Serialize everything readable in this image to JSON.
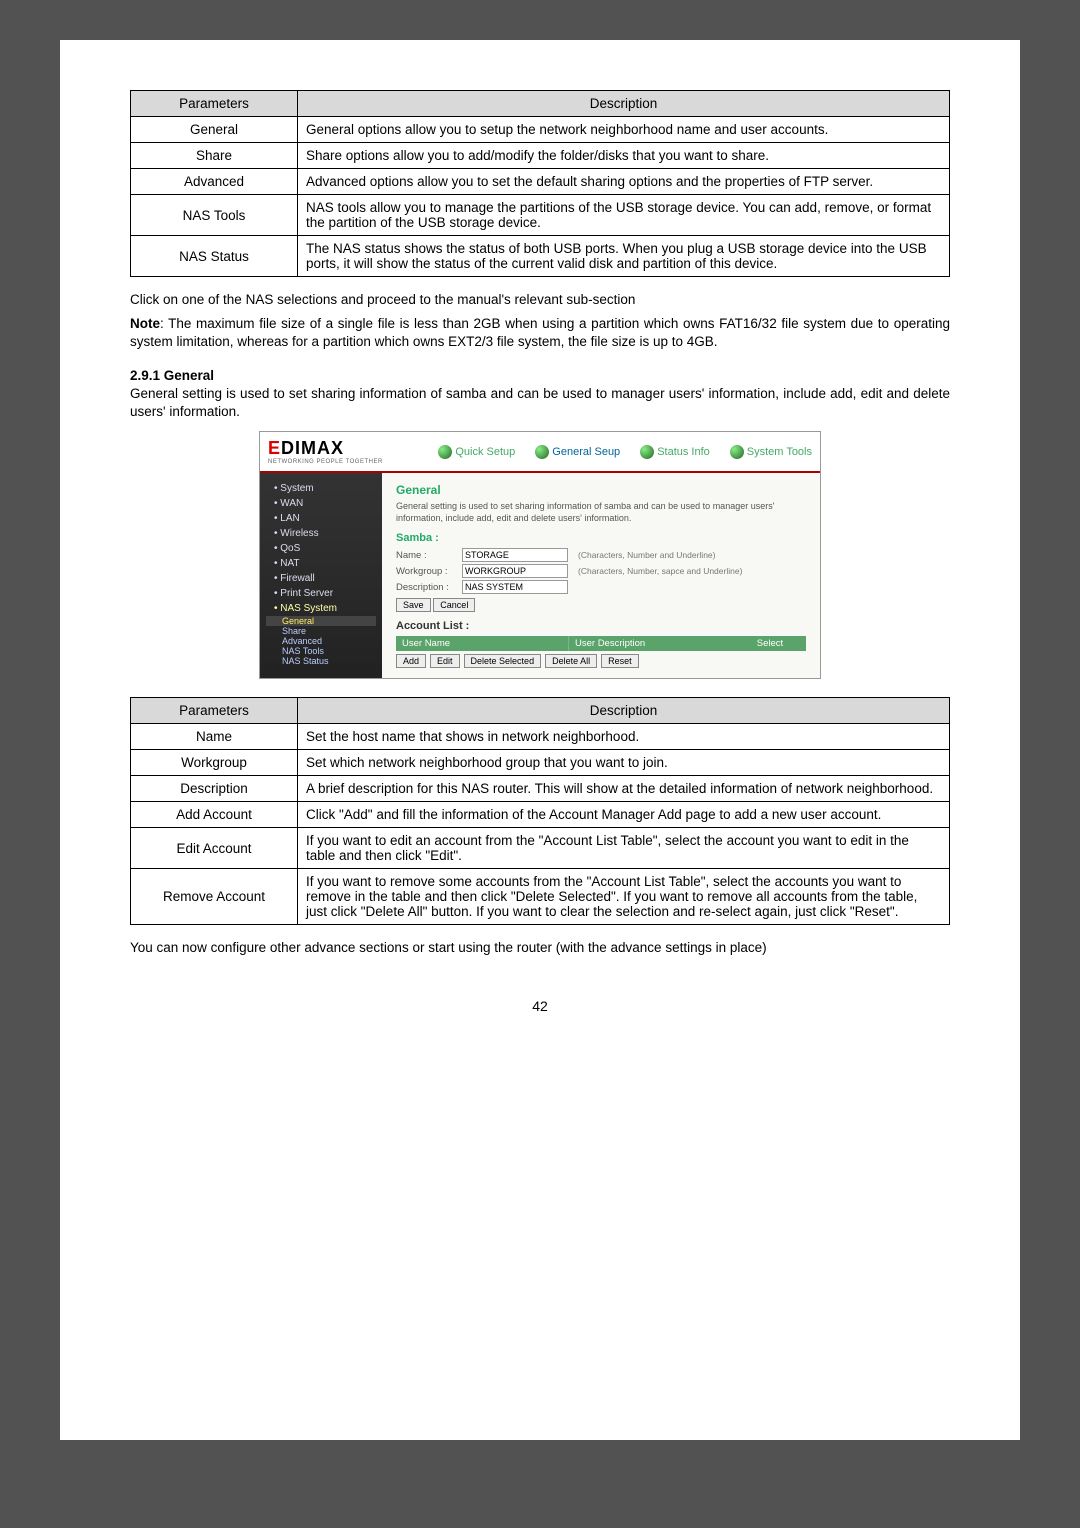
{
  "table1": {
    "h1": "Parameters",
    "h2": "Description",
    "rows": [
      {
        "p": "General",
        "d": "General options allow you to setup the network neighborhood name and user accounts."
      },
      {
        "p": "Share",
        "d": "Share options allow you to add/modify the folder/disks that you want to share."
      },
      {
        "p": "Advanced",
        "d": "Advanced options allow you to set the default sharing options and the properties of FTP server."
      },
      {
        "p": "NAS Tools",
        "d": "NAS tools allow you to manage the partitions of the USB storage device. You can add, remove, or format the partition of the USB storage device."
      },
      {
        "p": "NAS Status",
        "d": "The NAS status shows the status of both USB ports. When you plug a USB storage device into the USB ports, it will show the status of the current valid disk and partition of this device."
      }
    ]
  },
  "para1": "Click on one of the NAS selections and proceed to the manual's relevant sub-section",
  "note_label": "Note",
  "note_body": ": The maximum file size of a single file is less than 2GB when using a partition which owns FAT16/32 file system due to operating system limitation, whereas for a partition which owns EXT2/3 file system, the file size is up to 4GB.",
  "section_head": "2.9.1 General",
  "section_body": "General setting is used to set sharing information of samba and can be used to manager users' information, include add, edit and delete users' information.",
  "shot": {
    "logo": "EDIMAX",
    "logo_sub": "NETWORKING PEOPLE TOGETHER",
    "nav": [
      "Quick Setup",
      "General Seup",
      "Status Info",
      "System Tools"
    ],
    "side": [
      "System",
      "WAN",
      "LAN",
      "Wireless",
      "QoS",
      "NAT",
      "Firewall",
      "Print Server",
      "NAS System"
    ],
    "side_sub": [
      "General",
      "Share",
      "Advanced",
      "NAS Tools",
      "NAS Status"
    ],
    "title": "General",
    "intro": "General setting is used to set sharing information of samba and can be used to manager users' information, include add, edit and delete users' information.",
    "samba": "Samba :",
    "name_l": "Name :",
    "name_v": "STORAGE",
    "name_h": "(Characters, Number and Underline)",
    "wg_l": "Workgroup :",
    "wg_v": "WORKGROUP",
    "wg_h": "(Characters, Number, sapce and Underline)",
    "desc_l": "Description :",
    "desc_v": "NAS SYSTEM",
    "save": "Save",
    "cancel": "Cancel",
    "acct_label": "Account List :",
    "acct_h1": "User Name",
    "acct_h2": "User Description",
    "acct_h3": "Select",
    "btns": [
      "Add",
      "Edit",
      "Delete Selected",
      "Delete All",
      "Reset"
    ]
  },
  "table2": {
    "h1": "Parameters",
    "h2": "Description",
    "rows": [
      {
        "p": "Name",
        "d": "Set the host name that shows in network neighborhood."
      },
      {
        "p": "Workgroup",
        "d": "Set which network neighborhood group that you want to join."
      },
      {
        "p": "Description",
        "d": "A brief description for this NAS router. This will show at the detailed information of network neighborhood."
      },
      {
        "p": "Add Account",
        "d": "Click \"Add\" and fill the information of the Account Manager Add page to add a new user account."
      },
      {
        "p": "Edit Account",
        "d": "If you want to edit an account from the \"Account List Table\", select the account you want to edit in the table and then click \"Edit\"."
      },
      {
        "p": "Remove Account",
        "d": "If you want to remove some accounts from the \"Account List Table\", select the accounts you want to remove in the table and then click \"Delete Selected\". If you want to remove all accounts from the table, just click \"Delete All\" button. If you want to clear the selection and re-select again, just click \"Reset\"."
      }
    ]
  },
  "closing": "You can now configure other advance sections or start using the router (with the advance settings in place)",
  "page_num": "42"
}
